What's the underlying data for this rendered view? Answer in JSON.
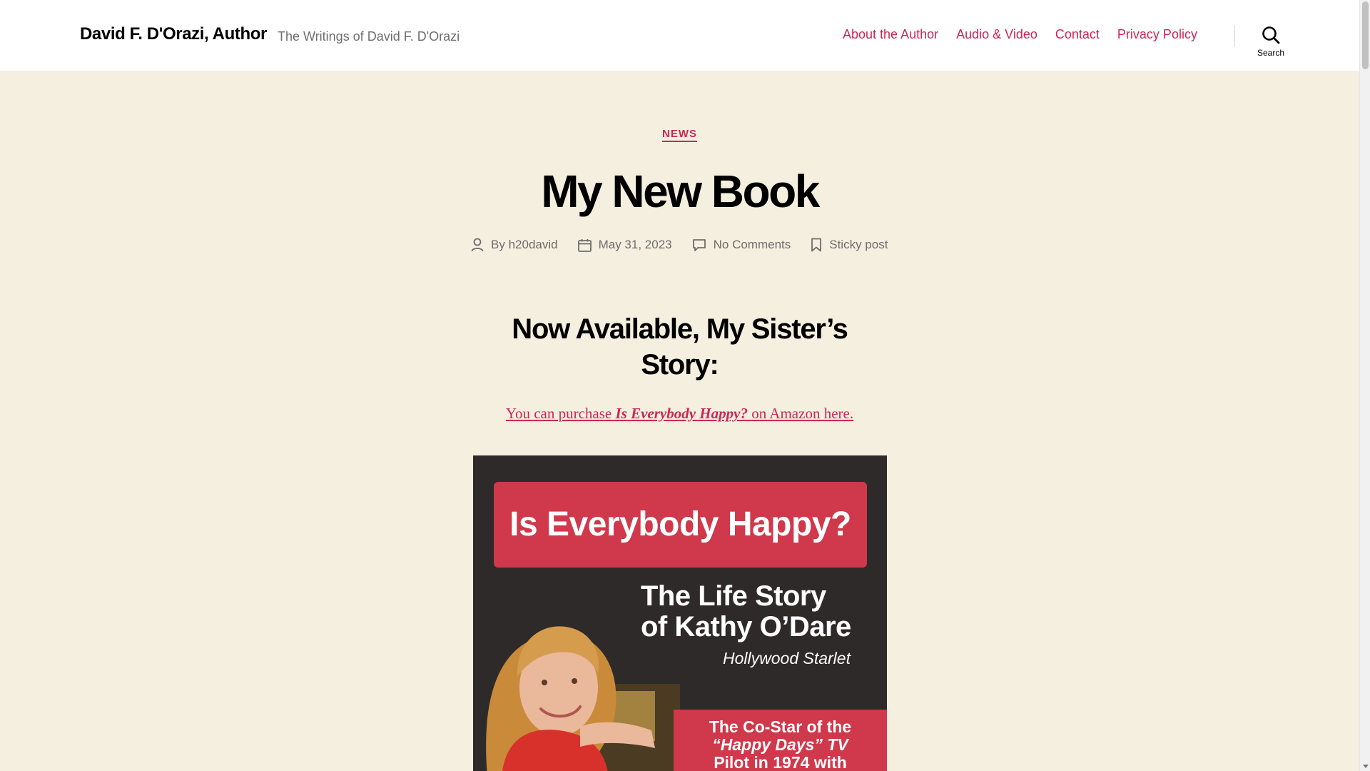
{
  "site": {
    "title": "David F. D'Orazi, Author",
    "description": "The Writings of David F. D'Orazi"
  },
  "nav": {
    "items": [
      {
        "label": "About the Author"
      },
      {
        "label": "Audio & Video"
      },
      {
        "label": "Contact"
      },
      {
        "label": "Privacy Policy"
      }
    ],
    "search_label": "Search"
  },
  "post": {
    "category": "NEWS",
    "title": "My New Book",
    "meta": {
      "by_prefix": "By",
      "author": "h20david",
      "date": "May 31, 2023",
      "comments": "No Comments",
      "sticky": "Sticky post"
    },
    "heading": "Now Available, My Sister’s Story:",
    "purchase": {
      "before": "You can purchase ",
      "book_title": "Is Everybody Happy?",
      "after": " on Amazon here."
    }
  },
  "cover": {
    "banner": "Is Everybody Happy?",
    "subtitle_line1": "The Life Story",
    "subtitle_line2": "of Kathy O’Dare",
    "starlet": "Hollywood Starlet",
    "box_line1": "The Co-Star of the",
    "box_line2": "“Happy Days” TV",
    "box_line3": "Pilot in 1974 with"
  },
  "colors": {
    "accent": "#cd2653",
    "background": "#f5efe0",
    "header_bg": "#ffffff",
    "cover_bg": "#2e2a29",
    "cover_red": "#d0384b"
  }
}
